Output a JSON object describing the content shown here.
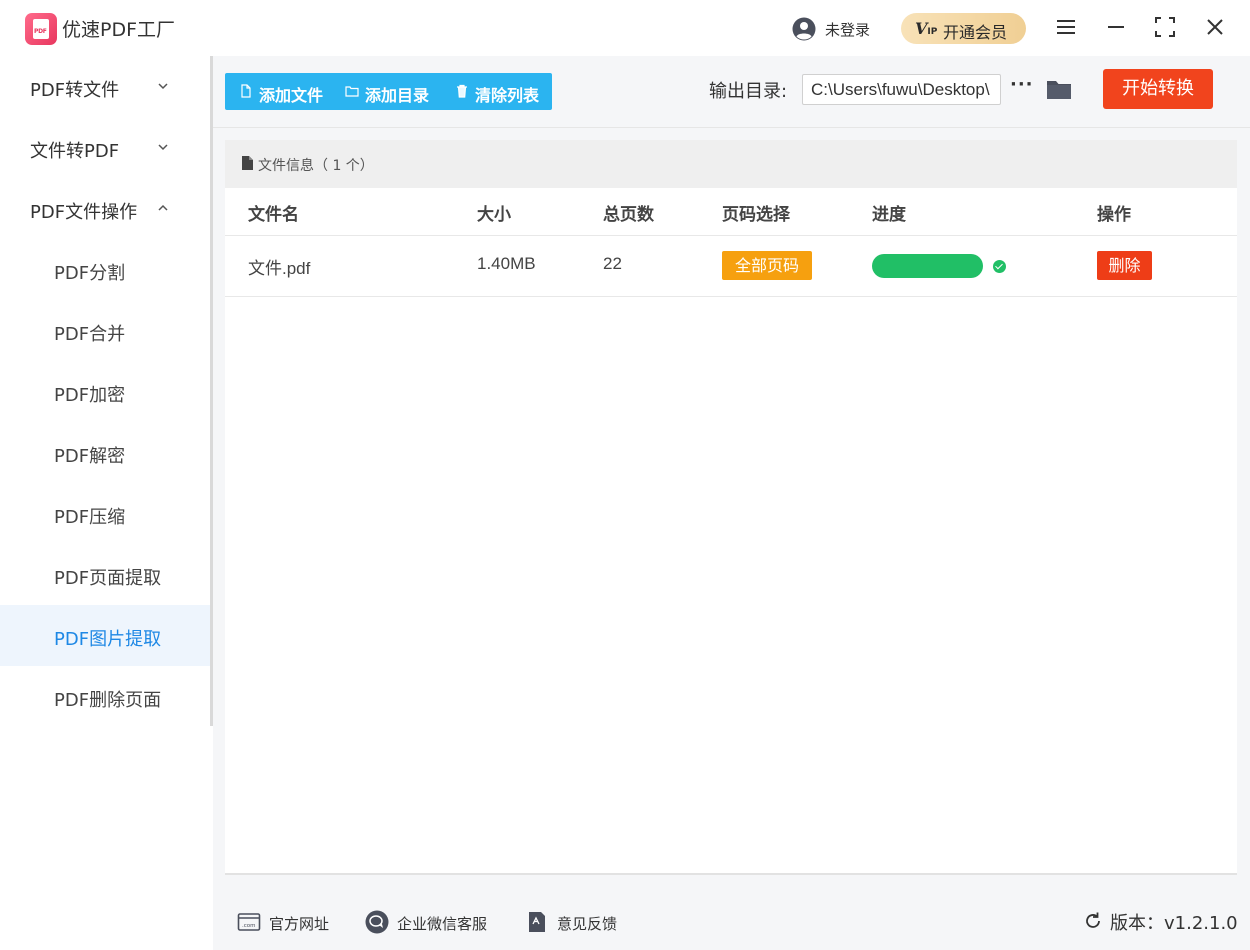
{
  "app": {
    "title": "优速PDF工厂",
    "login_text": "未登录",
    "vip_badge": "V",
    "vip_badge_sub": "IP",
    "vip_label": "开通会员"
  },
  "sidebar": {
    "groups": [
      {
        "label": "PDF转文件",
        "expanded": false
      },
      {
        "label": "文件转PDF",
        "expanded": false
      },
      {
        "label": "PDF文件操作",
        "expanded": true
      }
    ],
    "items": [
      {
        "label": "PDF分割"
      },
      {
        "label": "PDF合并"
      },
      {
        "label": "PDF加密"
      },
      {
        "label": "PDF解密"
      },
      {
        "label": "PDF压缩"
      },
      {
        "label": "PDF页面提取"
      },
      {
        "label": "PDF图片提取",
        "active": true
      },
      {
        "label": "PDF删除页面"
      }
    ]
  },
  "toolbar": {
    "add_file": "添加文件",
    "add_dir": "添加目录",
    "clear_list": "清除列表",
    "output_label": "输出目录:",
    "output_path": "C:\\Users\\fuwu\\Desktop\\",
    "more": "···",
    "start": "开始转换"
  },
  "file_panel": {
    "header": "文件信息（ 1 个）",
    "columns": [
      "文件名",
      "大小",
      "总页数",
      "页码选择",
      "进度",
      "操作"
    ],
    "rows": [
      {
        "name": "文件.pdf",
        "size": "1.40MB",
        "pages": "22",
        "page_select": "全部页码",
        "progress": 1.0,
        "action": "删除"
      }
    ]
  },
  "footer": {
    "website": "官方网址",
    "wechat": "企业微信客服",
    "feedback": "意见反馈",
    "version": "版本：v1.2.1.0"
  },
  "colors": {
    "accent_blue": "#2bb4f0",
    "start_orange": "#f1441d",
    "badge_orange": "#f6a00f",
    "progress_green": "#21bf66",
    "delete_red": "#ee3d17",
    "active_nav": "#1e88e5"
  }
}
